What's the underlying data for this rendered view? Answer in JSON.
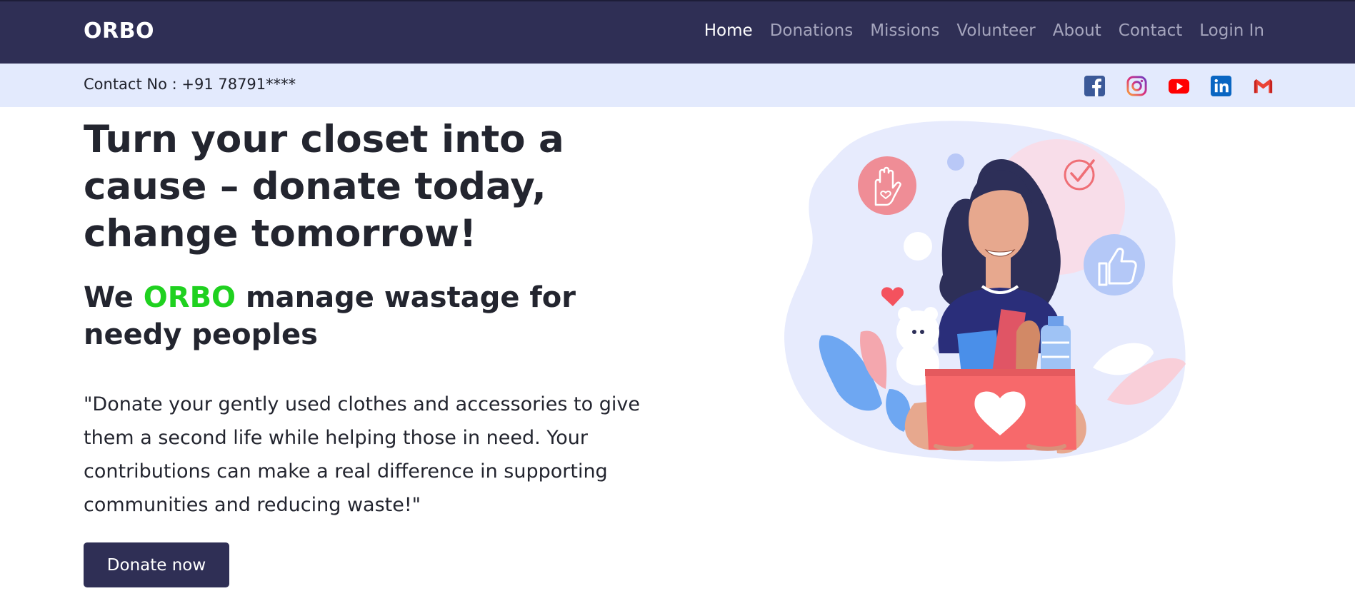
{
  "brand": "ORBO",
  "nav": {
    "items": [
      {
        "label": "Home",
        "active": true
      },
      {
        "label": "Donations",
        "active": false
      },
      {
        "label": "Missions",
        "active": false
      },
      {
        "label": "Volunteer",
        "active": false
      },
      {
        "label": "About",
        "active": false
      },
      {
        "label": "Contact",
        "active": false
      },
      {
        "label": "Login In",
        "active": false
      }
    ]
  },
  "infobar": {
    "contact": "Contact No : +91 78791****",
    "socials": [
      "facebook-icon",
      "instagram-icon",
      "youtube-icon",
      "linkedin-icon",
      "gmail-icon"
    ]
  },
  "hero": {
    "title": "Turn your closet into a cause – donate today, change tomorrow!",
    "subtitle_prefix": "We",
    "subtitle_brand": "ORBO",
    "subtitle_suffix": "manage wastage for needy peoples",
    "quote": "\"Donate your gently used clothes and accessories to give them a second life while helping those in need. Your contributions can make a real difference in supporting communities and reducing waste!\"",
    "cta": "Donate now"
  },
  "colors": {
    "nav_bg": "#2f2f55",
    "info_bg": "#e3eafd",
    "brand_green": "#1fd11f",
    "box_red": "#f7696b"
  }
}
